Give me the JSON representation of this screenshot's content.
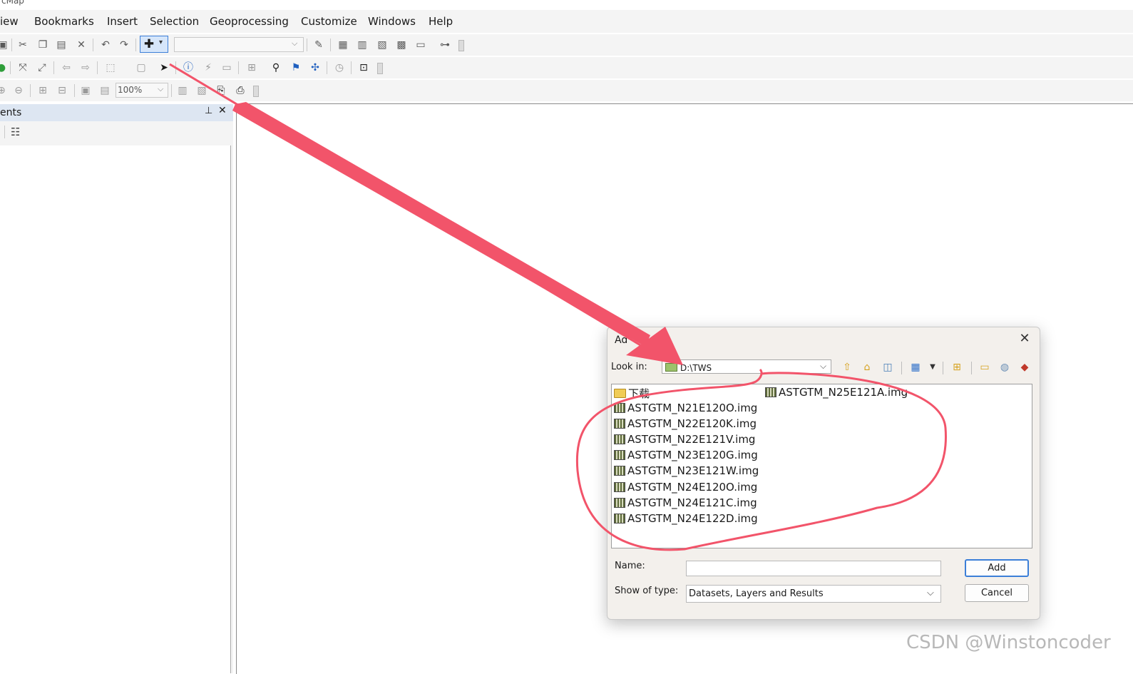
{
  "app": {
    "title_fragment": "cMap"
  },
  "menubar": {
    "items": [
      "View",
      "Bookmarks",
      "Insert",
      "Selection",
      "Geoprocessing",
      "Customize",
      "Windows",
      "Help"
    ],
    "first_item_visible": "iew"
  },
  "toolbar": {
    "zoom_value": "100%"
  },
  "toc": {
    "title_fragment": "ents",
    "pin_glyph": "⊥",
    "close_glyph": "✕"
  },
  "dialog": {
    "title_fragment": "Ad",
    "close_glyph": "✕",
    "look_in_label": "Look in:",
    "look_in_value": "D:\\TWS",
    "items": [
      {
        "name": "下载",
        "kind": "folder"
      },
      {
        "name": "ASTGTM_N25E121A.img",
        "kind": "raster"
      },
      {
        "name": "ASTGTM_N21E120O.img",
        "kind": "raster"
      },
      {
        "name": "ASTGTM_N22E120K.img",
        "kind": "raster"
      },
      {
        "name": "ASTGTM_N22E121V.img",
        "kind": "raster"
      },
      {
        "name": "ASTGTM_N23E120G.img",
        "kind": "raster"
      },
      {
        "name": "ASTGTM_N23E121W.img",
        "kind": "raster"
      },
      {
        "name": "ASTGTM_N24E120O.img",
        "kind": "raster"
      },
      {
        "name": "ASTGTM_N24E121C.img",
        "kind": "raster"
      },
      {
        "name": "ASTGTM_N24E122D.img",
        "kind": "raster"
      }
    ],
    "name_label": "Name:",
    "name_value": "",
    "type_label": "Show of type:",
    "type_value": "Datasets, Layers and Results",
    "add_label": "Add",
    "cancel_label": "Cancel"
  },
  "watermark": "CSDN @Winstoncoder",
  "colors": {
    "annotation_red": "#f2546a",
    "accent_blue": "#3c7fd8"
  }
}
